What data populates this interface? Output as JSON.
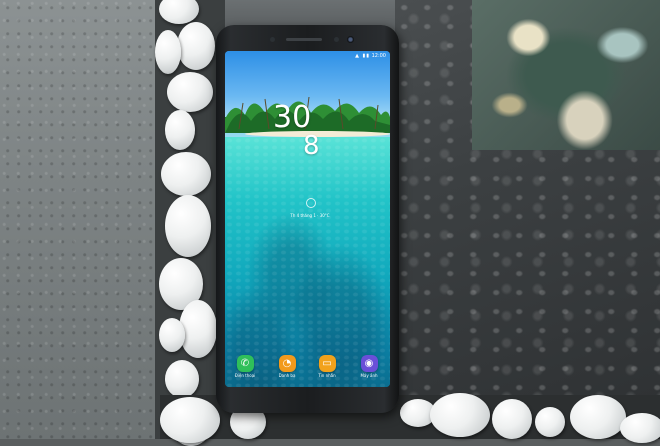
{
  "scene": {
    "description_kind": "photograph",
    "phone_model_text": "",
    "colors": {
      "phone_body": "#1b1d1f",
      "sky": "#2d8fe6",
      "sea": "#14b9c3",
      "pebble": "#eef0f0"
    }
  },
  "phone": {
    "status_bar": {
      "icons": "▲ ▮▮ ",
      "time": "12:00"
    },
    "clock": {
      "hours": "30",
      "minutes": "8"
    },
    "date": "Th 4 tháng 1 · 30°C",
    "dock": [
      {
        "label": "Điện thoại",
        "icon": "phone-icon",
        "color": "#2fbf5a",
        "glyph": "✆"
      },
      {
        "label": "Danh bạ",
        "icon": "contacts-icon",
        "color": "#f29a1c",
        "glyph": "👤"
      },
      {
        "label": "Tin nhắn",
        "icon": "messages-icon",
        "color": "#f2a21c",
        "glyph": "✉"
      },
      {
        "label": "Máy ảnh",
        "icon": "camera-icon",
        "color": "#6a4fd8",
        "glyph": "◉"
      }
    ],
    "navbar": {
      "recent": "recent-apps-icon",
      "home": "home-icon",
      "back": "back-icon"
    }
  }
}
